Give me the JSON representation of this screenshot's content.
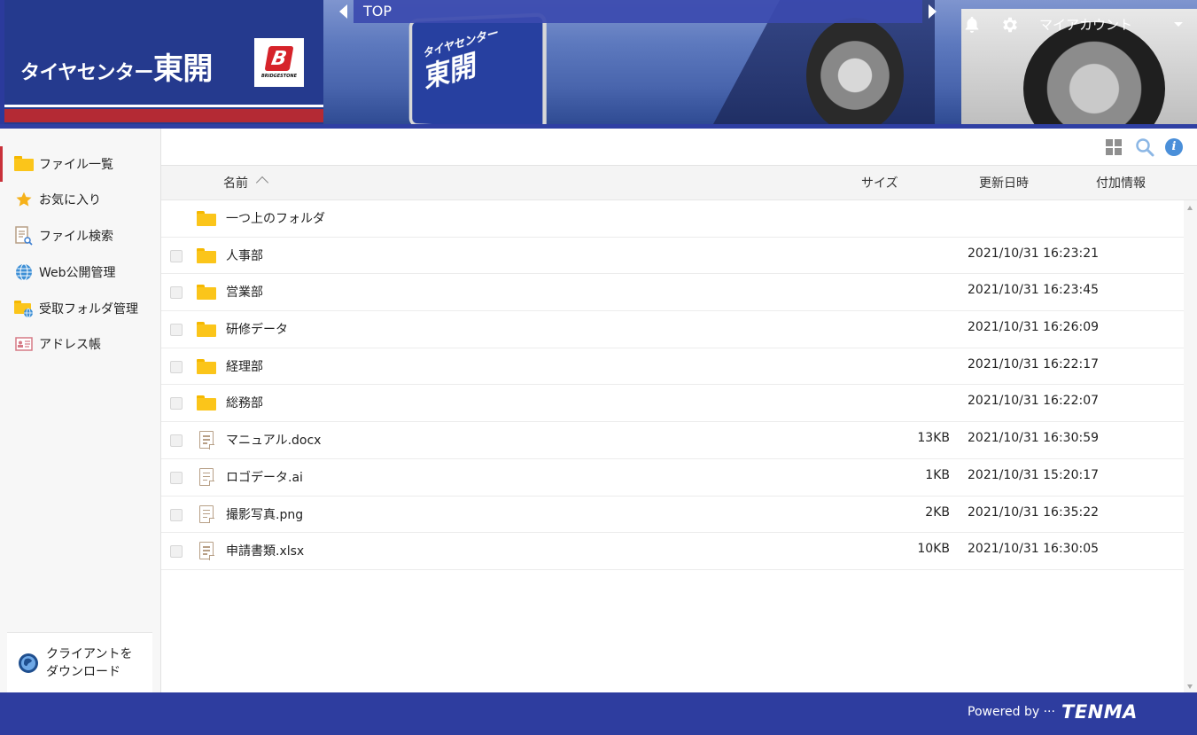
{
  "header": {
    "brand_small": "タイヤセンター",
    "brand_big": "東開",
    "partner_logo_text": "BRIDGESTONE",
    "partner_logo_letter": "B",
    "breadcrumb_top": "TOP",
    "banner_sign_small": "タイヤセンター",
    "banner_sign_big": "東開",
    "my_account": "マイアカウント"
  },
  "sidebar": {
    "items": [
      {
        "label": "ファイル一覧",
        "icon": "folder-icon",
        "active": true
      },
      {
        "label": "お気に入り",
        "icon": "star-icon"
      },
      {
        "label": "ファイル検索",
        "icon": "file-search-icon"
      },
      {
        "label": "Web公開管理",
        "icon": "globe-icon"
      },
      {
        "label": "受取フォルダ管理",
        "icon": "receive-folder-icon"
      },
      {
        "label": "アドレス帳",
        "icon": "address-book-icon"
      }
    ],
    "client_download_line1": "クライアントを",
    "client_download_line2": "ダウンロード"
  },
  "table": {
    "columns": {
      "name": "名前",
      "size": "サイズ",
      "updated": "更新日時",
      "extra": "付加情報"
    },
    "parent_folder": "一つ上のフォルダ",
    "rows": [
      {
        "type": "folder",
        "name": "人事部",
        "size": "",
        "updated": "2021/10/31 16:23:21"
      },
      {
        "type": "folder",
        "name": "営業部",
        "size": "",
        "updated": "2021/10/31 16:23:45"
      },
      {
        "type": "folder",
        "name": "研修データ",
        "size": "",
        "updated": "2021/10/31 16:26:09"
      },
      {
        "type": "folder",
        "name": "経理部",
        "size": "",
        "updated": "2021/10/31 16:22:17"
      },
      {
        "type": "folder",
        "name": "総務部",
        "size": "",
        "updated": "2021/10/31 16:22:07"
      },
      {
        "type": "file",
        "name": "マニュアル.docx",
        "size": "13KB",
        "updated": "2021/10/31 16:30:59"
      },
      {
        "type": "file",
        "name": "ロゴデータ.ai",
        "size": "1KB",
        "updated": "2021/10/31 15:20:17"
      },
      {
        "type": "file",
        "name": "撮影写真.png",
        "size": "2KB",
        "updated": "2021/10/31 16:35:22"
      },
      {
        "type": "file",
        "name": "申請書類.xlsx",
        "size": "10KB",
        "updated": "2021/10/31 16:30:05"
      }
    ]
  },
  "footer": {
    "powered_by": "Powered by ···",
    "logo_text": "TENMA"
  },
  "colors": {
    "brand_blue": "#2e3d9f",
    "accent_red": "#b42a34",
    "folder_yellow": "#fbc51a",
    "info_blue": "#4a8fd9"
  }
}
